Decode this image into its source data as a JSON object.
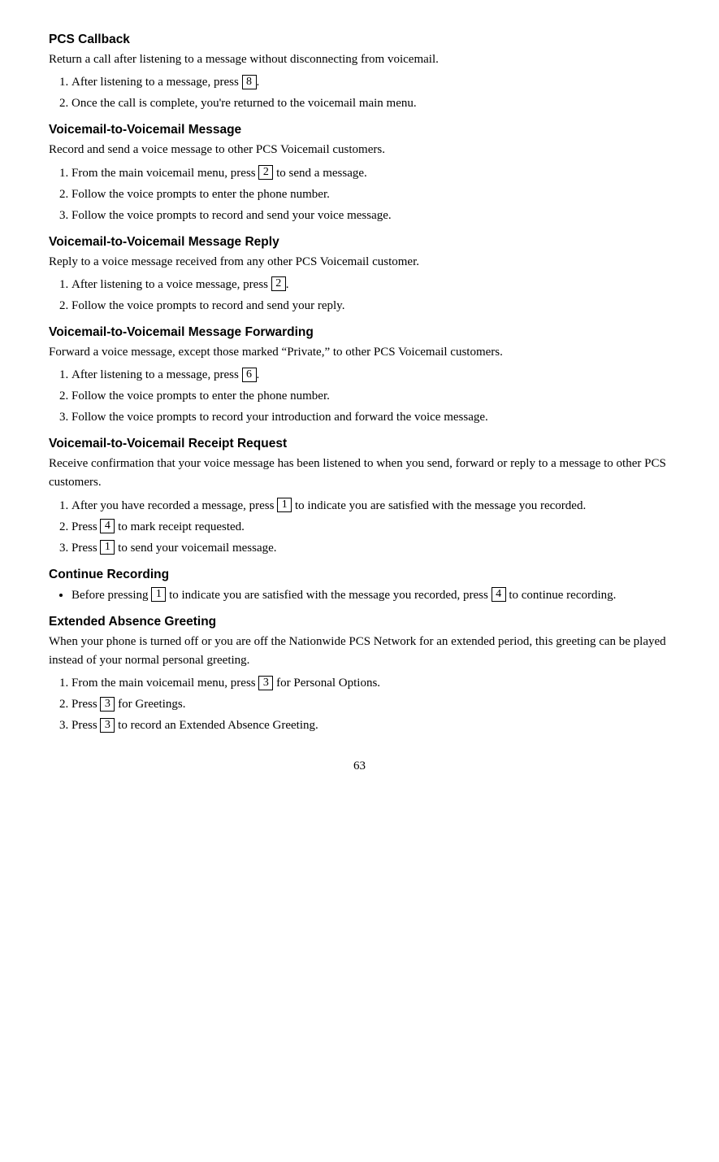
{
  "page": {
    "number": "63"
  },
  "sections": [
    {
      "id": "pcs-callback",
      "title": "PCS Callback",
      "intro": "Return a call after listening to a message without disconnecting from voicemail.",
      "steps": [
        {
          "num": 1,
          "text_before": "After listening to a message, press ",
          "key": "8",
          "text_after": "."
        },
        {
          "num": 2,
          "text_before": "Once the call is complete, you’re returned to the voicemail main menu.",
          "key": null,
          "text_after": ""
        }
      ]
    },
    {
      "id": "voicemail-to-voicemail-message",
      "title": "Voicemail-to-Voicemail Message",
      "intro": "Record and send a voice message to other PCS Voicemail customers.",
      "steps": [
        {
          "num": 1,
          "text_before": "From the main voicemail menu, press ",
          "key": "2",
          "text_after": " to send a message."
        },
        {
          "num": 2,
          "text_before": "Follow the voice prompts to enter the phone number.",
          "key": null,
          "text_after": ""
        },
        {
          "num": 3,
          "text_before": "Follow the voice prompts to record and send your voice message.",
          "key": null,
          "text_after": ""
        }
      ]
    },
    {
      "id": "voicemail-to-voicemail-reply",
      "title": "Voicemail-to-Voicemail Message Reply",
      "intro": "Reply to a voice message received from any other PCS Voicemail customer.",
      "steps": [
        {
          "num": 1,
          "text_before": "After listening to a voice message, press ",
          "key": "2",
          "text_after": "."
        },
        {
          "num": 2,
          "text_before": "Follow the voice prompts to record and send your reply.",
          "key": null,
          "text_after": ""
        }
      ]
    },
    {
      "id": "voicemail-to-voicemail-forwarding",
      "title": "Voicemail-to-Voicemail Message Forwarding",
      "intro": "Forward a voice message, except those marked “Private,” to other PCS Voicemail customers.",
      "steps": [
        {
          "num": 1,
          "text_before": "After listening to a message, press ",
          "key": "6",
          "text_after": "."
        },
        {
          "num": 2,
          "text_before": "Follow the voice prompts to enter the phone number.",
          "key": null,
          "text_after": ""
        },
        {
          "num": 3,
          "text_before": "Follow the voice prompts to record your introduction and forward the voice message.",
          "key": null,
          "text_after": ""
        }
      ]
    },
    {
      "id": "voicemail-receipt-request",
      "title": "Voicemail-to-Voicemail Receipt Request",
      "intro": "Receive confirmation that your voice message has been listened to when you send, forward or reply to a message to other PCS customers.",
      "steps": [
        {
          "num": 1,
          "text_before": "After you have recorded a message, press ",
          "key": "1",
          "text_after": " to indicate you are satisfied with the message you recorded."
        },
        {
          "num": 2,
          "text_before": "Press ",
          "key": "4",
          "text_after": " to mark receipt requested."
        },
        {
          "num": 3,
          "text_before": "Press ",
          "key": "1",
          "text_after": " to send your voicemail message."
        }
      ]
    },
    {
      "id": "continue-recording",
      "title": "Continue Recording",
      "bullets": [
        {
          "text_before": "Before pressing ",
          "key1": "1",
          "text_middle": " to indicate you are satisfied with the message you recorded, press ",
          "key2": "4",
          "text_after": " to continue recording."
        }
      ]
    },
    {
      "id": "extended-absence-greeting",
      "title": "Extended Absence Greeting",
      "intro": "When your phone is turned off or you are off the Nationwide PCS Network for an extended period, this greeting can be played instead of your normal personal greeting.",
      "steps": [
        {
          "num": 1,
          "text_before": "From the main voicemail menu, press ",
          "key": "3",
          "text_after": " for Personal Options."
        },
        {
          "num": 2,
          "text_before": "Press ",
          "key": "3",
          "text_after": " for Greetings."
        },
        {
          "num": 3,
          "text_before": "Press ",
          "key": "3",
          "text_after": " to record an Extended Absence Greeting."
        }
      ]
    }
  ]
}
